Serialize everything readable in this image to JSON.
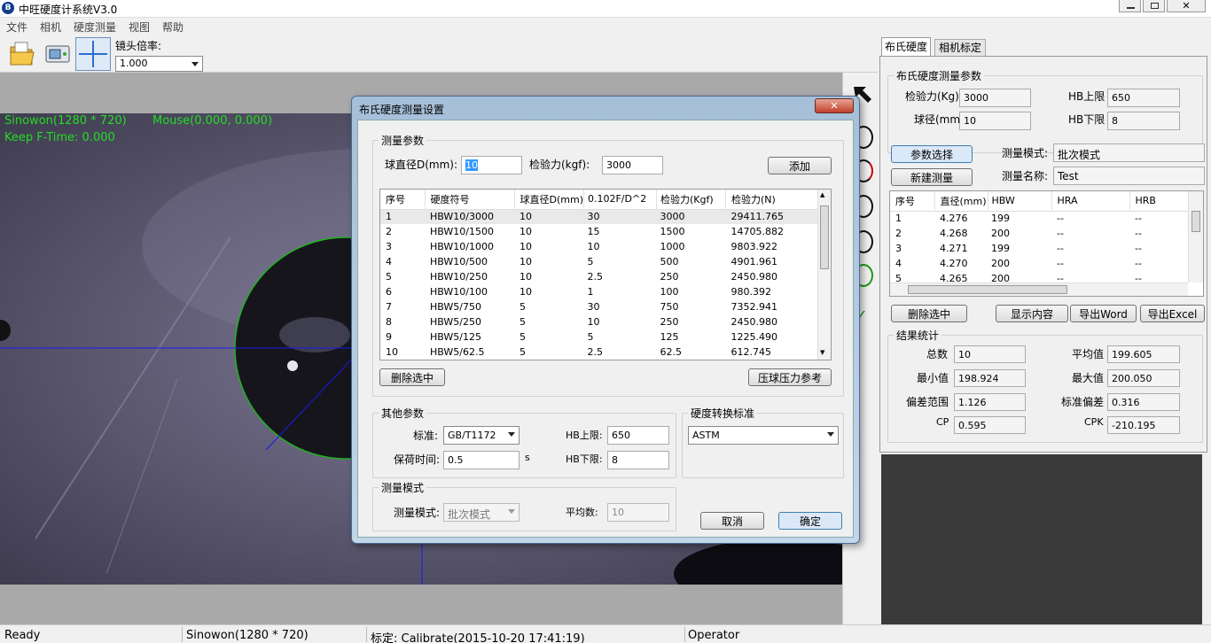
{
  "window": {
    "title": "中旺硬度计系统V3.0"
  },
  "menu": [
    "文件",
    "相机",
    "硬度测量",
    "视图",
    "帮助"
  ],
  "toolbar": {
    "lens_label": "镜头倍率:",
    "lens_value": "1.000"
  },
  "overlay": {
    "resolution": "Sinowon(1280 * 720)",
    "mouse": "Mouse(0.000, 0.000)",
    "keep_time": "Keep F-Time: 0.000"
  },
  "dialog": {
    "title": "布氏硬度测量设置",
    "params_group": "测量参数",
    "ball_label": "球直径D(mm):",
    "ball_value": "10",
    "force_label": "检验力(kgf):",
    "force_value": "3000",
    "add_btn": "添加",
    "table": {
      "headers": [
        "序号",
        "硬度符号",
        "球直径D(mm)",
        "0.102F/D^2",
        "检验力(Kgf)",
        "检验力(N)"
      ],
      "rows": [
        [
          "1",
          "HBW10/3000",
          "10",
          "30",
          "3000",
          "29411.765"
        ],
        [
          "2",
          "HBW10/1500",
          "10",
          "15",
          "1500",
          "14705.882"
        ],
        [
          "3",
          "HBW10/1000",
          "10",
          "10",
          "1000",
          "9803.922"
        ],
        [
          "4",
          "HBW10/500",
          "10",
          "5",
          "500",
          "4901.961"
        ],
        [
          "5",
          "HBW10/250",
          "10",
          "2.5",
          "250",
          "2450.980"
        ],
        [
          "6",
          "HBW10/100",
          "10",
          "1",
          "100",
          "980.392"
        ],
        [
          "7",
          "HBW5/750",
          "5",
          "30",
          "750",
          "7352.941"
        ],
        [
          "8",
          "HBW5/250",
          "5",
          "10",
          "250",
          "2450.980"
        ],
        [
          "9",
          "HBW5/125",
          "5",
          "5",
          "125",
          "1225.490"
        ],
        [
          "10",
          "HBW5/62.5",
          "5",
          "2.5",
          "62.5",
          "612.745"
        ]
      ]
    },
    "delete_btn": "删除选中",
    "press_btn": "压球压力参考",
    "other_group": "其他参数",
    "standard_label": "标准:",
    "standard_value": "GB/T1172",
    "hb_upper_label": "HB上限:",
    "hb_upper_value": "650",
    "hold_label": "保荷时间:",
    "hold_value": "0.5",
    "hold_unit": "s",
    "hb_lower_label": "HB下限:",
    "hb_lower_value": "8",
    "convert_group": "硬度转换标准",
    "convert_value": "ASTM",
    "mode_group": "测量模式",
    "mode_label": "测量模式:",
    "mode_value": "批次模式",
    "avg_label": "平均数:",
    "avg_value": "10",
    "cancel_btn": "取消",
    "ok_btn": "确定"
  },
  "right": {
    "tabs": [
      "布氏硬度",
      "相机标定"
    ],
    "params_group": "布氏硬度测量参数",
    "force_label": "检验力(Kg)",
    "force_value": "3000",
    "hb_upper_label": "HB上限",
    "hb_upper_value": "650",
    "ball_label": "球径(mm)",
    "ball_value": "10",
    "hb_lower_label": "HB下限",
    "hb_lower_value": "8",
    "param_select_btn": "参数选择",
    "new_measure_btn": "新建测量",
    "mode_label": "测量模式:",
    "mode_value": "批次模式",
    "name_label": "测量名称:",
    "name_value": "Test",
    "table": {
      "headers": [
        "序号",
        "直径(mm)",
        "HBW",
        "HRA",
        "HRB"
      ],
      "rows": [
        [
          "1",
          "4.276",
          "199",
          "--",
          "--"
        ],
        [
          "2",
          "4.268",
          "200",
          "--",
          "--"
        ],
        [
          "3",
          "4.271",
          "199",
          "--",
          "--"
        ],
        [
          "4",
          "4.270",
          "200",
          "--",
          "--"
        ],
        [
          "5",
          "4.265",
          "200",
          "--",
          "--"
        ]
      ]
    },
    "delete_btn": "删除选中",
    "show_btn": "显示内容",
    "word_btn": "导出Word",
    "excel_btn": "导出Excel",
    "stats_group": "结果统计",
    "total_label": "总数",
    "total_value": "10",
    "avg_label": "平均值",
    "avg_value": "199.605",
    "min_label": "最小值",
    "min_value": "198.924",
    "max_label": "最大值",
    "max_value": "200.050",
    "range_label": "偏差范围",
    "range_value": "1.126",
    "std_label": "标准偏差",
    "std_value": "0.316",
    "cp_label": "CP",
    "cp_value": "0.595",
    "cpk_label": "CPK",
    "cpk_value": "-210.195"
  },
  "status": {
    "ready": "Ready",
    "camera": "Sinowon(1280 * 720)",
    "calib": "标定: Calibrate(2015-10-20 17:41:19)",
    "user": "Operator"
  }
}
